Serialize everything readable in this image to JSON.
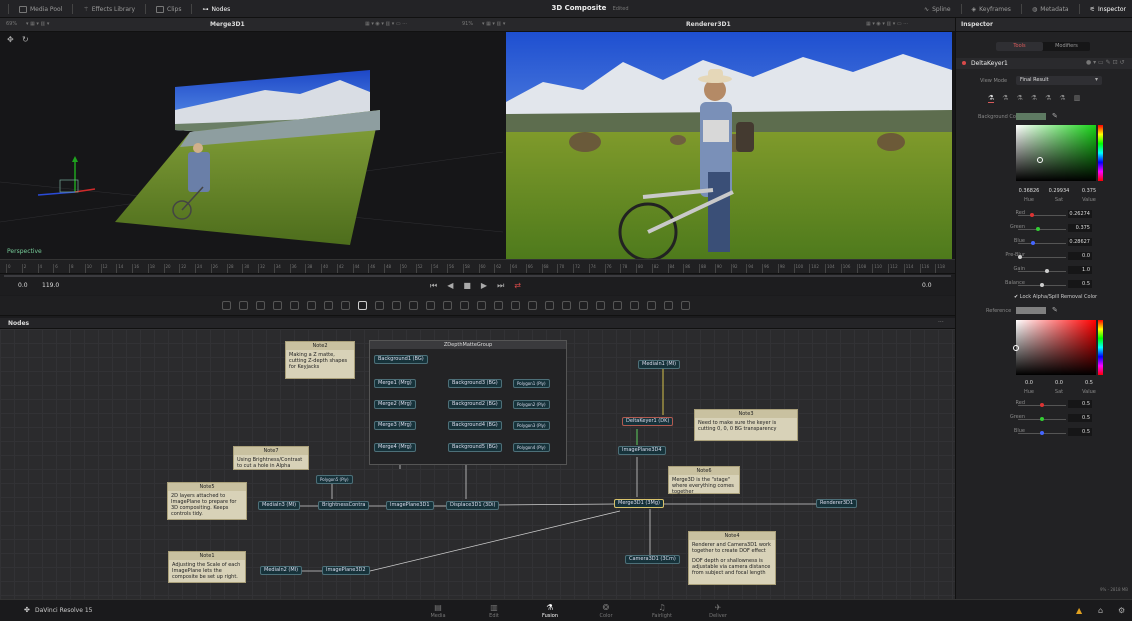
{
  "topbar": {
    "left_buttons": [
      "Media Pool",
      "Effects Library",
      "Clips",
      "Nodes"
    ],
    "title": "3D Composite",
    "status": "Edited",
    "right_buttons": [
      "Spline",
      "Keyframes",
      "Metadata",
      "Inspector"
    ]
  },
  "viewer1": {
    "zoom": "69%",
    "name": "Merge3D1",
    "label": "Perspective"
  },
  "viewer2": {
    "zoom": "91%",
    "name": "Renderer3D1"
  },
  "timeline": {
    "ticks": [
      "0",
      "2",
      "4",
      "6",
      "8",
      "10",
      "12",
      "14",
      "16",
      "18",
      "20",
      "22",
      "24",
      "26",
      "28",
      "30",
      "32",
      "34",
      "36",
      "38",
      "40",
      "42",
      "44",
      "46",
      "48",
      "50",
      "52",
      "54",
      "56",
      "58",
      "60",
      "62",
      "64",
      "66",
      "68",
      "70",
      "72",
      "74",
      "76",
      "78",
      "80",
      "82",
      "84",
      "86",
      "88",
      "90",
      "92",
      "94",
      "96",
      "98",
      "100",
      "102",
      "104",
      "106",
      "108",
      "110",
      "112",
      "114",
      "116",
      "118"
    ]
  },
  "transport": {
    "start": "0.0",
    "end": "119.0",
    "current": "0.0"
  },
  "nodes_panel": {
    "title": "Nodes"
  },
  "group": {
    "title": "ZDepthMatteGroup"
  },
  "nodes": {
    "bg1": "Background1 (BG)",
    "merge1": "Merge1 (Mrg)",
    "merge2": "Merge2 (Mrg)",
    "merge3": "Merge3 (Mrg)",
    "merge4": "Merge4 (Mrg)",
    "bg3": "Background3 (BG)",
    "bg2": "Background2 (BG)",
    "bg4": "Background4 (BG)",
    "bg5": "Background5 (BG)",
    "poly1": "Polygon1 (Ply)",
    "poly2": "Polygon2 (Ply)",
    "poly3": "Polygon3 (Ply)",
    "poly4": "Polygon4 (Ply)",
    "poly5": "Polygon5 (Ply)",
    "media1": "MediaIn1 (MI)",
    "deltakeyer": "DeltaKeyer1 (DK)",
    "imageplane3d4": "ImagePlane3D4",
    "media3": "MediaIn3 (MI)",
    "brightness": "BrightnessContra",
    "imageplane3d1": "ImagePlane3D1",
    "displace": "Displace3D1 (3Di)",
    "merge3d": "Merge3D1 (3Mg)",
    "renderer": "Renderer3D1",
    "camera": "Camera3D1 (3Cm)",
    "media2": "MediaIn2 (MI)",
    "imageplane3d2": "ImagePlane3D2"
  },
  "notes": {
    "note2": {
      "title": "Note2",
      "body": "Making a Z matte, cutting Z-depth shapes for Keyjacks"
    },
    "note3": {
      "title": "Note3",
      "body": "Need to make sure the keyer is cutting 0, 0, 0 BG transparency"
    },
    "note7": {
      "title": "Note7",
      "body": "Using Brightness/Contrast to cut a hole in Alpha"
    },
    "note6": {
      "title": "Note6",
      "body": "Merge3D is the \"stage\" where everything comes together"
    },
    "note5": {
      "title": "Note5",
      "body": "2D layers attached to ImagePlane to prepare for 3D compositing. Keeps controls tidy."
    },
    "note4": {
      "title": "Note4",
      "body": "Renderer and Camera3D1 work together to create DOF effect",
      "body2": "DOF depth or shallowness is adjustable via camera distance from subject and focal length"
    },
    "note1": {
      "title": "Note1",
      "body": "Adjusting the Scale of each ImagePlane lets the composite be set up right."
    }
  },
  "inspector": {
    "title": "Inspector",
    "tabs": [
      "Tools",
      "Modifiers"
    ],
    "node_name": "DeltaKeyer1",
    "view_mode_label": "View Mode",
    "view_mode_value": "Final Result",
    "bg_color_label": "Background Color",
    "hsv": {
      "hue": "0.36826",
      "sat": "0.29934",
      "value": "0.375",
      "hue_label": "Hue",
      "sat_label": "Sat",
      "value_label": "Value"
    },
    "red_label": "Red",
    "red": "0.26274",
    "green_label": "Green",
    "green": "0.375",
    "blue_label": "Blue",
    "blue": "0.28627",
    "preblur_label": "Pre-Blur",
    "preblur": "0.0",
    "gain_label": "Gain",
    "gain": "1.0",
    "balance_label": "Balance",
    "balance": "0.5",
    "lock_label": "Lock Alpha/Spill Removal Color",
    "reference_label": "Reference",
    "ref_hsv": {
      "hue": "0.0",
      "sat": "0.0",
      "value": "0.5",
      "hue_label": "Hue",
      "sat_label": "Sat",
      "value_label": "Value"
    },
    "ref_red": "0.5",
    "ref_green": "0.5",
    "ref_blue": "0.5",
    "bg_swatch": "#5e7a62",
    "ref_swatch": "#808080"
  },
  "bottombar": {
    "app": "DaVinci Resolve 15",
    "pages": [
      "Media",
      "Edit",
      "Fusion",
      "Color",
      "Fairlight",
      "Deliver"
    ],
    "active_page": "Fusion",
    "memory": "9% - 2818 MB"
  }
}
